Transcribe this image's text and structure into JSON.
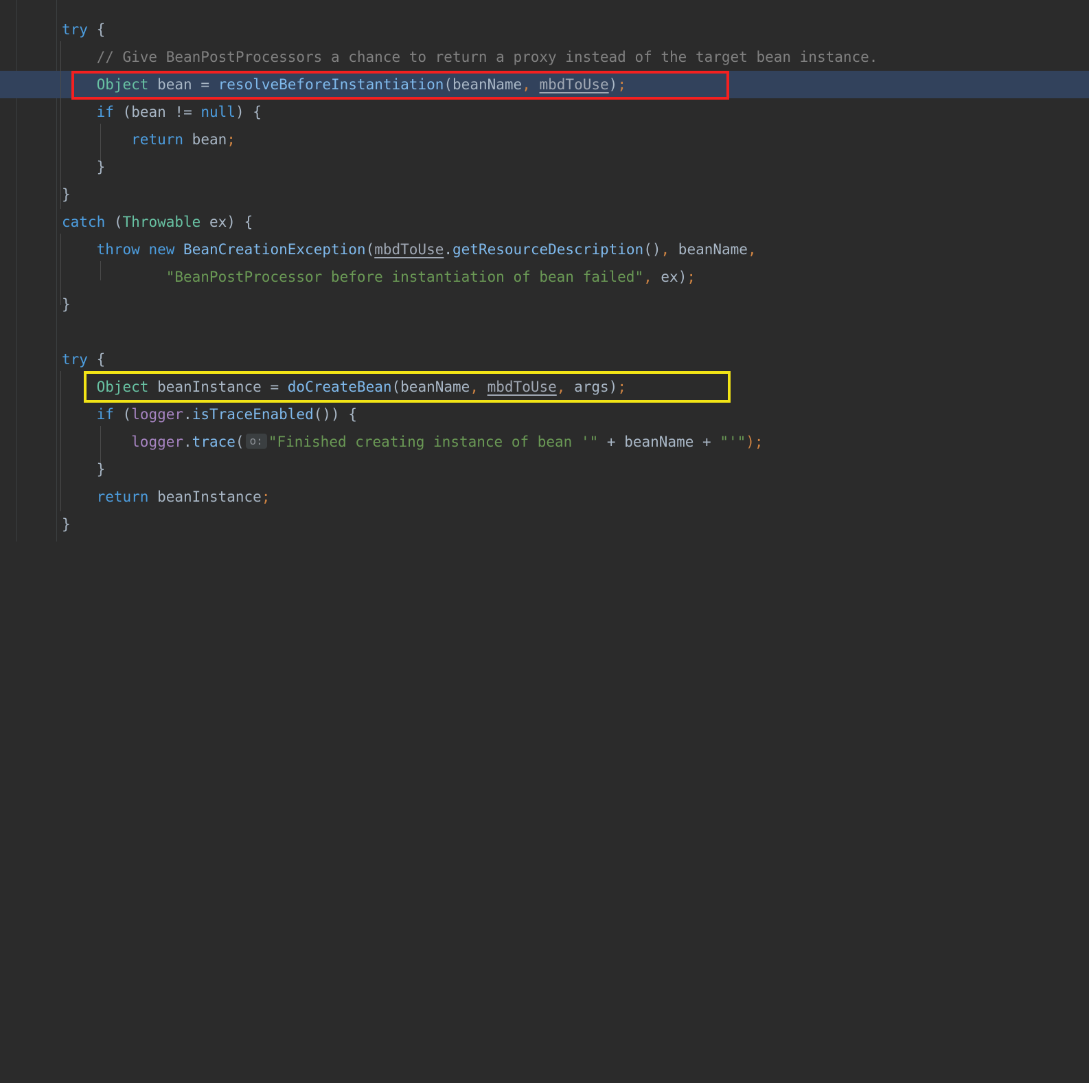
{
  "editor": {
    "theme": "darcula",
    "background": "#2b2b2b",
    "caret_line_color": "#32425c",
    "font_size_px": 21,
    "line_height_px": 40
  },
  "annotations": [
    {
      "name": "red-highlight-box",
      "color": "#f42020",
      "target_line": 3,
      "target_text": "Object bean = resolveBeforeInstantiation(beanName, mbdToUse);"
    },
    {
      "name": "yellow-highlight-box",
      "color": "#f2e416",
      "target_line": 14,
      "target_text": "Object beanInstance = doCreateBean(beanName, mbdToUse, args);"
    }
  ],
  "parameter_hint": {
    "label": "o:"
  },
  "code": {
    "language": "java",
    "lines": [
      {
        "n": 1,
        "text": "    try {"
      },
      {
        "n": 2,
        "text": "        // Give BeanPostProcessors a chance to return a proxy instead of the target bean instance."
      },
      {
        "n": 3,
        "text": "        Object bean = resolveBeforeInstantiation(beanName, mbdToUse);"
      },
      {
        "n": 4,
        "text": "        if (bean != null) {"
      },
      {
        "n": 5,
        "text": "            return bean;"
      },
      {
        "n": 6,
        "text": "        }"
      },
      {
        "n": 7,
        "text": "    }"
      },
      {
        "n": 8,
        "text": "    catch (Throwable ex) {"
      },
      {
        "n": 9,
        "text": "        throw new BeanCreationException(mbdToUse.getResourceDescription(), beanName,"
      },
      {
        "n": 10,
        "text": "                \"BeanPostProcessor before instantiation of bean failed\", ex);"
      },
      {
        "n": 11,
        "text": "    }"
      },
      {
        "n": 12,
        "text": ""
      },
      {
        "n": 13,
        "text": "    try {"
      },
      {
        "n": 14,
        "text": "        Object beanInstance = doCreateBean(beanName, mbdToUse, args);"
      },
      {
        "n": 15,
        "text": "        if (logger.isTraceEnabled()) {"
      },
      {
        "n": 16,
        "text": "            logger.trace( o: \"Finished creating instance of bean '\" + beanName + \"'\");"
      },
      {
        "n": 17,
        "text": "        }"
      },
      {
        "n": 18,
        "text": "        return beanInstance;"
      },
      {
        "n": 19,
        "text": "    }"
      }
    ]
  },
  "tokens": {
    "l1": {
      "try": "try",
      "brace": "{"
    },
    "l2": {
      "comment": "// Give BeanPostProcessors a chance to return a proxy instead of the target bean instance."
    },
    "l3": {
      "type": "Object",
      "var": "bean",
      "eq": "=",
      "call": "resolveBeforeInstantiation",
      "arg1": "beanName",
      "arg2": "mbdToUse",
      "semi": ";"
    },
    "l4": {
      "if": "if",
      "var": "bean",
      "op": "!=",
      "null": "null",
      "brace": "{"
    },
    "l5": {
      "return": "return",
      "var": "bean",
      "semi": ";"
    },
    "l6": {
      "brace": "}"
    },
    "l7": {
      "brace": "}"
    },
    "l8": {
      "catch": "catch",
      "type": "Throwable",
      "var": "ex",
      "brace": "{"
    },
    "l9": {
      "throw": "throw",
      "new": "new",
      "class": "BeanCreationException",
      "field": "mbdToUse",
      "call": "getResourceDescription",
      "arg": "beanName"
    },
    "l10": {
      "string": "\"BeanPostProcessor before instantiation of bean failed\"",
      "var": "ex"
    },
    "l11": {
      "brace": "}"
    },
    "l13": {
      "try": "try",
      "brace": "{"
    },
    "l14": {
      "type": "Object",
      "var": "beanInstance",
      "eq": "=",
      "call": "doCreateBean",
      "arg1": "beanName",
      "arg2": "mbdToUse",
      "arg3": "args",
      "semi": ";"
    },
    "l15": {
      "if": "if",
      "logger": "logger",
      "call": "isTraceEnabled",
      "brace": "{"
    },
    "l16": {
      "logger": "logger",
      "call": "trace",
      "hint": "o:",
      "str1": "\"Finished creating instance of bean '\"",
      "plus": "+",
      "var": "beanName",
      "plus2": "+",
      "str2": "\"'\"",
      "semi": ");"
    },
    "l17": {
      "brace": "}"
    },
    "l18": {
      "return": "return",
      "var": "beanInstance",
      "semi": ";"
    },
    "l19": {
      "brace": "}"
    }
  }
}
